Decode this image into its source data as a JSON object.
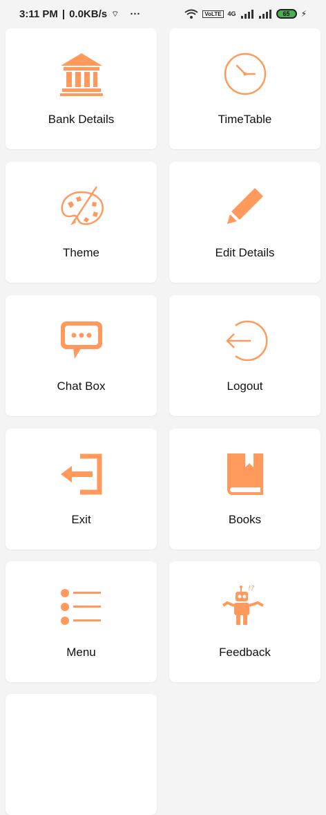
{
  "status_bar": {
    "time": "3:11 PM",
    "speed": "0.0KB/s",
    "more": "···",
    "network": "4G",
    "battery": "65"
  },
  "accent_color": "#ff9a5c",
  "grid": [
    {
      "label": "Bank Details",
      "icon": "bank-icon"
    },
    {
      "label": "TimeTable",
      "icon": "clock-icon"
    },
    {
      "label": "Theme",
      "icon": "palette-icon"
    },
    {
      "label": "Edit Details",
      "icon": "pencil-icon"
    },
    {
      "label": "Chat Box",
      "icon": "chat-icon"
    },
    {
      "label": "Logout",
      "icon": "logout-icon"
    },
    {
      "label": "Exit",
      "icon": "exit-icon"
    },
    {
      "label": "Books",
      "icon": "book-icon"
    },
    {
      "label": "Menu",
      "icon": "menu-list-icon"
    },
    {
      "label": "Feedback",
      "icon": "robot-icon"
    }
  ]
}
